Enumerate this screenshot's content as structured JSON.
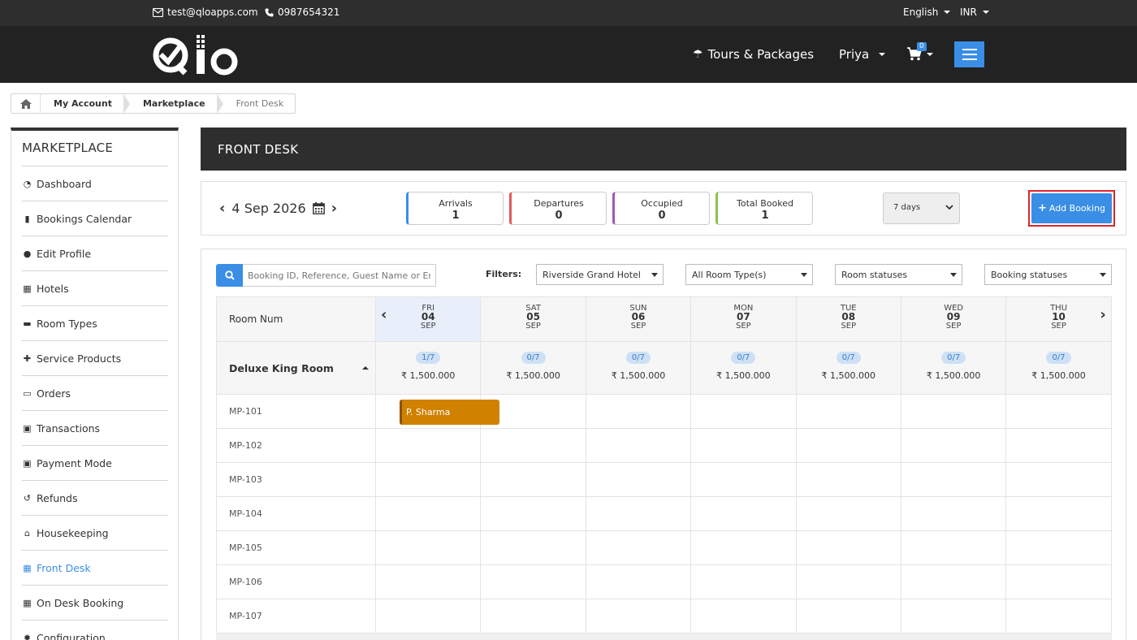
{
  "topbar": {
    "email": "test@qloapps.com",
    "phone": "0987654321",
    "language": "English",
    "currency": "INR"
  },
  "header": {
    "logo_text": "Qlo",
    "tours": "Tours & Packages",
    "user": "Priya",
    "cart_count": "0"
  },
  "breadcrumb": [
    "My Account",
    "Marketplace",
    "Front Desk"
  ],
  "sidebar": {
    "title": "MARKETPLACE",
    "items": [
      {
        "label": "Dashboard",
        "icon": "dashboard-icon"
      },
      {
        "label": "Bookings Calendar",
        "icon": "bar-chart-icon"
      },
      {
        "label": "Edit Profile",
        "icon": "user-icon"
      },
      {
        "label": "Hotels",
        "icon": "building-icon"
      },
      {
        "label": "Room Types",
        "icon": "bed-icon"
      },
      {
        "label": "Service Products",
        "icon": "user-plus-icon"
      },
      {
        "label": "Orders",
        "icon": "credit-card-icon"
      },
      {
        "label": "Transactions",
        "icon": "money-icon"
      },
      {
        "label": "Payment Mode",
        "icon": "money-icon"
      },
      {
        "label": "Refunds",
        "icon": "undo-icon"
      },
      {
        "label": "Housekeeping",
        "icon": "home-icon"
      },
      {
        "label": "Front Desk",
        "icon": "calendar-icon",
        "active": true
      },
      {
        "label": "On Desk Booking",
        "icon": "calendar-icon"
      },
      {
        "label": "Configuration",
        "icon": "gear-icon"
      }
    ]
  },
  "main": {
    "title": "FRONT DESK",
    "date": "4 Sep 2026",
    "stats": [
      {
        "label": "Arrivals",
        "value": "1",
        "color": "#3a8ee6"
      },
      {
        "label": "Departures",
        "value": "0",
        "color": "#e05a5a"
      },
      {
        "label": "Occupied",
        "value": "0",
        "color": "#9b59b6"
      },
      {
        "label": "Total Booked",
        "value": "1",
        "color": "#8bc34a"
      }
    ],
    "days_select": "7 days",
    "add_booking": "Add Booking"
  },
  "calendar": {
    "search_placeholder": "Booking ID, Reference, Guest Name or Email",
    "filters_label": "Filters:",
    "filters": [
      "Riverside Grand Hotel",
      "All Room Type(s)",
      "Room statuses",
      "Booking statuses"
    ],
    "room_num_label": "Room Num",
    "days": [
      {
        "dow": "FRI",
        "date": "04",
        "month": "SEP",
        "avail": "1/7",
        "price": "₹ 1,500.000"
      },
      {
        "dow": "SAT",
        "date": "05",
        "month": "SEP",
        "avail": "0/7",
        "price": "₹ 1,500.000"
      },
      {
        "dow": "SUN",
        "date": "06",
        "month": "SEP",
        "avail": "0/7",
        "price": "₹ 1,500.000"
      },
      {
        "dow": "MON",
        "date": "07",
        "month": "SEP",
        "avail": "0/7",
        "price": "₹ 1,500.000"
      },
      {
        "dow": "TUE",
        "date": "08",
        "month": "SEP",
        "avail": "0/7",
        "price": "₹ 1,500.000"
      },
      {
        "dow": "WED",
        "date": "09",
        "month": "SEP",
        "avail": "0/7",
        "price": "₹ 1,500.000"
      },
      {
        "dow": "THU",
        "date": "10",
        "month": "SEP",
        "avail": "0/7",
        "price": "₹ 1,500.000"
      }
    ],
    "room_type": "Deluxe King Room",
    "rooms": [
      "MP-101",
      "MP-102",
      "MP-103",
      "MP-104",
      "MP-105",
      "MP-106",
      "MP-107"
    ],
    "booking": {
      "guest": "P. Sharma",
      "color": "#d18100"
    }
  }
}
